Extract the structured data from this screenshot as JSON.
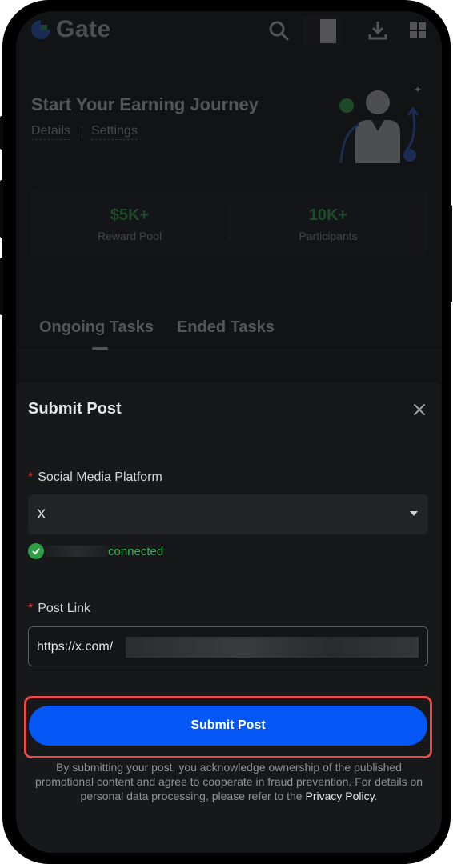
{
  "app": {
    "brand": "Gate"
  },
  "hero": {
    "title": "Start Your Earning Journey",
    "details_link": "Details",
    "settings_link": "Settings"
  },
  "stats": [
    {
      "value": "$5K+",
      "label": "Reward Pool"
    },
    {
      "value": "10K+",
      "label": "Participants"
    }
  ],
  "tabs": [
    "Ongoing Tasks",
    "Ended Tasks"
  ],
  "modal": {
    "title": "Submit Post",
    "platform_label": "Social Media Platform",
    "platform_value": "X",
    "connected_text": "connected",
    "post_link_label": "Post Link",
    "post_link_value": "https://x.com/",
    "submit_label": "Submit Post",
    "disclaimer": "By submitting your post, you acknowledge ownership of the published promotional content and agree to cooperate in fraud prevention. For details on personal data processing, please refer to the",
    "privacy_link": "Privacy Policy",
    "disclaimer_end": "."
  },
  "colors": {
    "accent_blue": "#0557f5",
    "success_green": "#2fb24d",
    "stat_green": "#3ddb56",
    "highlight_red": "#e84a4a",
    "required_red": "#e0403f"
  },
  "icons": [
    "gate-logo-icon",
    "search-icon",
    "download-icon",
    "grid-icon",
    "close-icon",
    "check-icon",
    "chevron-down-icon"
  ]
}
